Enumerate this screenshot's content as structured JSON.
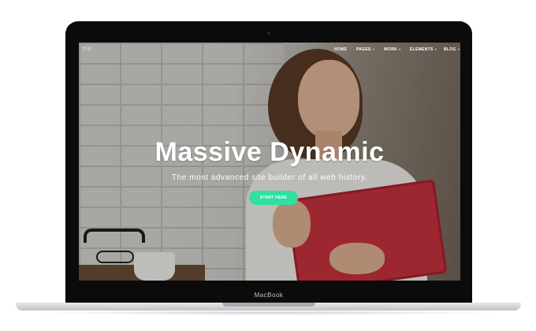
{
  "device": {
    "brand_label": "MacBook"
  },
  "site": {
    "logo_text": "TT-O",
    "nav": [
      {
        "label": "HOME",
        "has_dropdown": false
      },
      {
        "label": "PAGES",
        "has_dropdown": true
      },
      {
        "label": "WORK",
        "has_dropdown": true
      },
      {
        "label": "ELEMENTS",
        "has_dropdown": true
      },
      {
        "label": "BLOG",
        "has_dropdown": true
      }
    ],
    "dropdown_glyph": "˅"
  },
  "hero": {
    "title": "Massive Dynamic",
    "subtitle": "The most advanced site builder of all web history.",
    "cta_label": "START HERE"
  },
  "colors": {
    "cta": "#2fe0a1",
    "bezel": "#0b0b0c",
    "book": "#c8323f"
  }
}
